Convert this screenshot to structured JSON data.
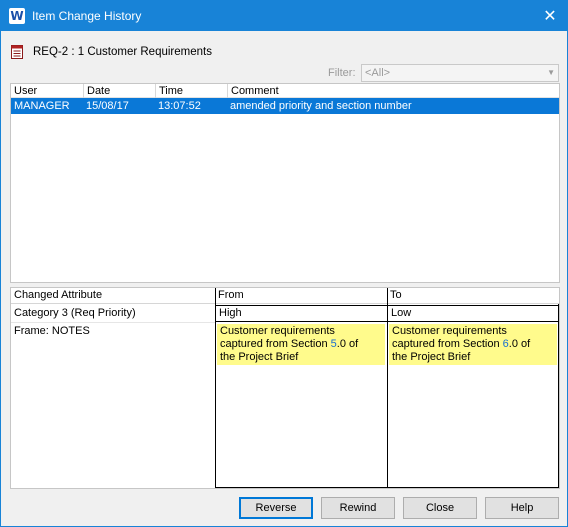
{
  "window": {
    "title": "Item Change History",
    "app_icon_letter": "W"
  },
  "item": {
    "label": "REQ-2 : 1 Customer Requirements"
  },
  "filter": {
    "label": "Filter:",
    "value": "<All>"
  },
  "history": {
    "columns": [
      "User",
      "Date",
      "Time",
      "Comment"
    ],
    "rows": [
      {
        "user": "MANAGER",
        "date": "15/08/17",
        "time": "13:07:52",
        "comment": "amended priority and section number"
      }
    ]
  },
  "attributes": {
    "columns": [
      "Changed Attribute",
      "From",
      "To"
    ],
    "rows": [
      {
        "name": "Category 3 (Req Priority)",
        "from": "High",
        "to": "Low"
      },
      {
        "name": "Frame: NOTES",
        "from_line1": "Customer requirements",
        "from_line2_a": "captured from Section ",
        "from_line2_b": "5",
        "from_line2_c": ".0 of",
        "from_line3": "the Project Brief",
        "to_line1": "Customer requirements",
        "to_line2_a": "captured from Section ",
        "to_line2_b": "6",
        "to_line2_c": ".0 of",
        "to_line3": "the Project Brief"
      }
    ]
  },
  "buttons": {
    "reverse": "Reverse",
    "rewind": "Rewind",
    "close": "Close",
    "help": "Help"
  },
  "colors": {
    "titlebar": "#1883d7",
    "selection": "#0a78d7",
    "highlight": "#fffb8c"
  }
}
